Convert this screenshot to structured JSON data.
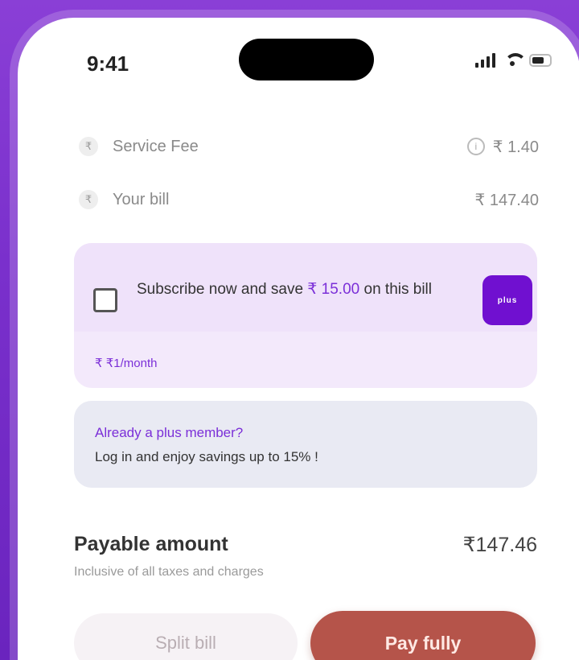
{
  "status_bar": {
    "time": "9:41"
  },
  "bill_rows": [
    {
      "badge": "₹",
      "label": "Service Fee",
      "value": "₹ 1.40",
      "has_info": true
    },
    {
      "badge": "₹",
      "label": "Your bill",
      "value": "₹ 147.40",
      "has_info": false
    }
  ],
  "subscribe": {
    "text_before": "Subscribe now and save ",
    "amount": "₹ 15.00",
    "text_after": " on this bill",
    "brand_logo_text": "plus",
    "footer": "₹ ₹1/month"
  },
  "member": {
    "title": "Already a plus member?",
    "subtitle": "Log in and enjoy savings up to 15% !"
  },
  "payable": {
    "label": "Payable amount",
    "value": "₹147.46",
    "subtext": "Inclusive of all taxes and charges"
  },
  "buttons": {
    "split": "Split bill",
    "pay": "Pay fully"
  },
  "colors": {
    "accent": "#7b2fd8",
    "pay_button": "#b5544a",
    "background": "#7a30cc"
  }
}
